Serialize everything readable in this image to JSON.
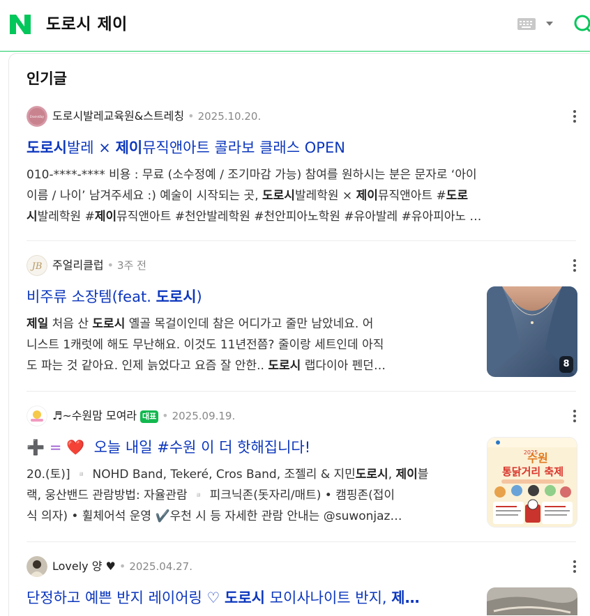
{
  "header": {
    "query": "도로시 제이"
  },
  "section": {
    "title": "인기글"
  },
  "posts": [
    {
      "author": "도로시발레교육원&스트레칭",
      "date": "2025.10.20.",
      "title_parts": [
        "도로시",
        "발레 × ",
        "제이",
        "뮤직앤아트 콜라보 클래스 OPEN"
      ],
      "desc_lines": [
        [
          "010-****-**** 비용 : 무료 (소수정예 / 조기마감 가능) 참여를 원하시는 분은 문자로 ‘아이"
        ],
        [
          "이름 / 나이’ 남겨주세요 :) 예술이 시작되는 곳, ",
          "도로시",
          "발레학원 × ",
          "제이",
          "뮤직앤아트 #",
          "도로"
        ],
        [
          "시",
          "발레학원 #",
          "제이",
          "뮤직앤아트 #천안발레학원 #천안피아노학원 #유아발레 #유아피아노 …"
        ]
      ]
    },
    {
      "author": "주얼리클럽",
      "date": "3주 전",
      "title_parts": [
        "비주류 소장템(feat. ",
        "도로시",
        ")"
      ],
      "desc_lines": [
        [
          "",
          "제일",
          " 처음 산 ",
          "도로시",
          " 옐골 목걸이인데 참은 어디가고 줄만 남았네요. 어"
        ],
        [
          "니스트 1캐럿에 해도 무난해요. 이것도 11년전쯤? 줄이랑 세트인데 아직"
        ],
        [
          "도 파는 것 같아요. 인제 늙었다고 요즘 잘 안한.. ",
          "도로시",
          " 랩다이아 펜던…"
        ]
      ],
      "thumb_count": "8"
    },
    {
      "author": "♬~수원맘 모여라",
      "badge": "대표",
      "date": "2025.09.19.",
      "title_emoji": "➕ = ❤️",
      "title_parts": [
        "오늘 내일 #수원 이 더 핫해집니다!"
      ],
      "desc_lines": [
        [
          "20.(토)]  ▫️ NOHD Band, Tekeré, Cros Band, 조젤리 & 지민",
          "도로시",
          ", ",
          "제이",
          "블"
        ],
        [
          "랙, 웅산밴드 관람방법: 자율관람  ▫️ 피크닉존(돗자리/매트) • 캠핑존(접이"
        ],
        [
          "식 의자) • 휠체어석 운영 ✔️우천 시 등 자세한 관람 안내는 @suwonjaz…"
        ]
      ],
      "poster_title": "수원 통닭거리 축제"
    },
    {
      "author": "Lovely 양 ♥",
      "date": "2025.04.27.",
      "title_parts": [
        "단정하고 예쁜 반지 레이어링 ♡ ",
        "도로시",
        " 모이사나이트 반지, ",
        "제…"
      ]
    }
  ],
  "colors": {
    "brand_green": "#03c75a",
    "title_blue": "#0b36bd",
    "badge_green": "#12b84f"
  },
  "icons": [
    "naver-logo-icon",
    "keyboard-icon",
    "dropdown-caret-icon",
    "search-icon",
    "more-options-icon",
    "heart-icon",
    "plus-icon",
    "checkmark-icon"
  ]
}
